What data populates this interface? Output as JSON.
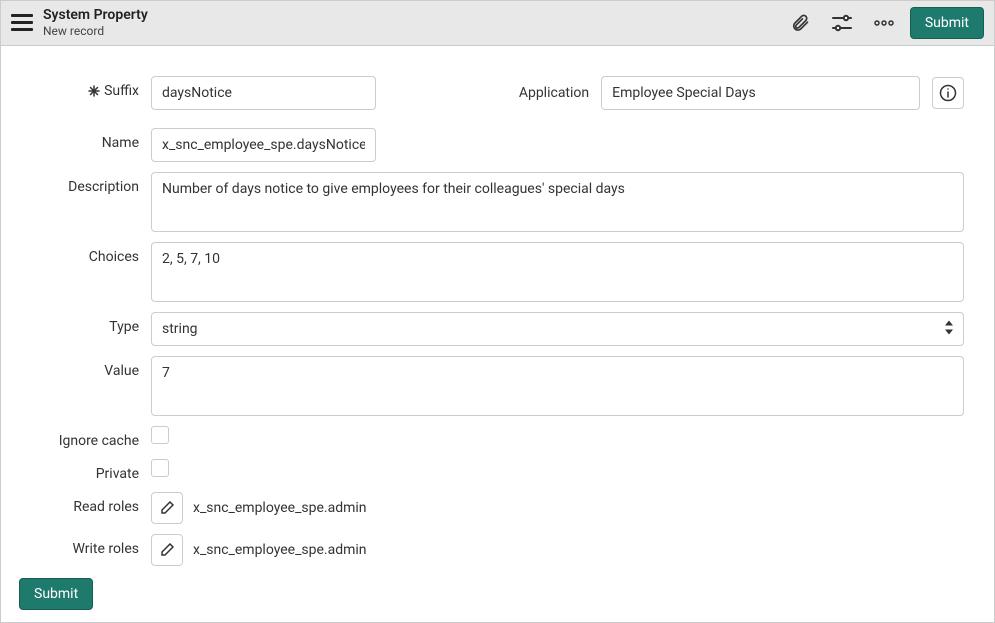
{
  "header": {
    "title": "System Property",
    "subtitle": "New record",
    "submit_label": "Submit"
  },
  "labels": {
    "suffix": "Suffix",
    "application": "Application",
    "name": "Name",
    "description": "Description",
    "choices": "Choices",
    "type": "Type",
    "value": "Value",
    "ignore_cache": "Ignore cache",
    "private": "Private",
    "read_roles": "Read roles",
    "write_roles": "Write roles"
  },
  "values": {
    "suffix": "daysNotice",
    "application": "Employee Special Days",
    "name": "x_snc_employee_spe.daysNotice",
    "description": "Number of days notice to give employees for their colleagues' special days",
    "choices": "2, 5, 7, 10",
    "type": "string",
    "value": "7",
    "read_roles": "x_snc_employee_spe.admin",
    "write_roles": "x_snc_employee_spe.admin"
  },
  "footer": {
    "submit_label": "Submit"
  }
}
